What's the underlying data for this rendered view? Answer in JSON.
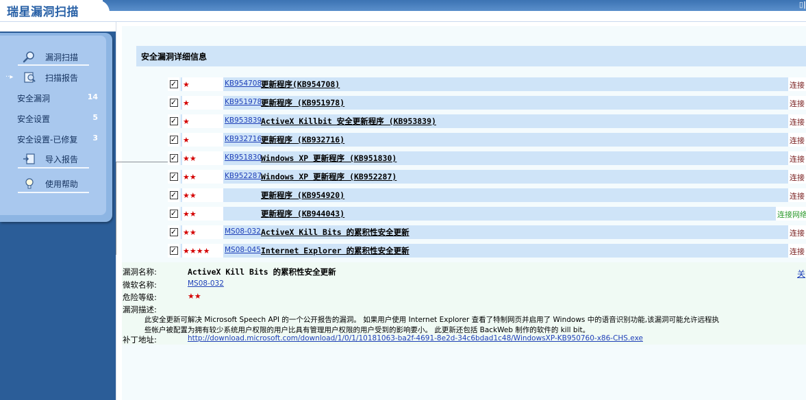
{
  "app": {
    "title": "瑞星漏洞扫描"
  },
  "sidebar": {
    "scan": "漏洞扫描",
    "report": "扫描报告",
    "items": [
      {
        "label": "安全漏洞",
        "count": "14"
      },
      {
        "label": "安全设置",
        "count": "5"
      },
      {
        "label": "安全设置-已修复",
        "count": "3"
      }
    ],
    "import": "导入报告",
    "help": "使用帮助"
  },
  "main": {
    "header": "安全漏洞详细信息",
    "rows": [
      {
        "stars": "★",
        "kb": "KB954708",
        "name": "更新程序(KB954708)",
        "status": "连接"
      },
      {
        "stars": "★",
        "kb": "KB951978",
        "name": "更新程序 (KB951978)",
        "status": "连接"
      },
      {
        "stars": "★",
        "kb": "KB953839",
        "name": "ActiveX Killbit 安全更新程序 (KB953839)",
        "status": "连接"
      },
      {
        "stars": "★",
        "kb": "KB932716",
        "name": "更新程序 (KB932716)",
        "status": "连接"
      },
      {
        "stars": "★★",
        "kb": "KB951830",
        "name": "Windows XP 更新程序 (KB951830)",
        "status": "连接"
      },
      {
        "stars": "★★",
        "kb": "KB952287",
        "name": "Windows XP 更新程序 (KB952287)",
        "status": "连接"
      },
      {
        "stars": "★★",
        "kb": "",
        "name": "更新程序 (KB954920)",
        "status": "连接"
      },
      {
        "stars": "★★",
        "kb": "",
        "name": "更新程序 (KB944043)",
        "status": "连接网络"
      },
      {
        "stars": "★★",
        "kb": "MS08-032",
        "name": "ActiveX Kill Bits 的累积性安全更新",
        "status": "连接"
      },
      {
        "stars": "★★★★",
        "kb": "MS08-045",
        "name": "Internet Explorer 的累积性安全更新",
        "status": "连接"
      }
    ],
    "checkmark": "✓"
  },
  "detail": {
    "name_label": "漏洞名称:",
    "name_value": "ActiveX Kill Bits 的累积性安全更新",
    "close": "关",
    "ms_label": "微软名称:",
    "ms_value": "MS08-032",
    "level_label": "危险等级:",
    "level_value": "★★",
    "desc_label": "漏洞描述:",
    "desc_line1": "此安全更新可解决 Microsoft Speech API 的一个公开报告的漏洞。 如果用户使用 Internet Explorer 查看了特制网页并启用了 Windows 中的语音识别功能,该漏洞可能允许远程执",
    "desc_line2": "些帐户被配置为拥有较少系统用户权限的用户比具有管理用户权限的用户受到的影响要小。 此更新还包括 BackWeb 制作的软件的 kill bit。",
    "patch_label": "补丁地址:",
    "patch_value": "http://download.microsoft.com/download/1/0/1/10181063-ba2f-4691-8e2d-34c6bdad1c48/WindowsXP-KB950760-x86-CHS.exe"
  },
  "colors": {
    "accent": "#2b5d98",
    "row": "#cfe4f8",
    "star": "#d40000",
    "link": "#1e3fb8"
  }
}
